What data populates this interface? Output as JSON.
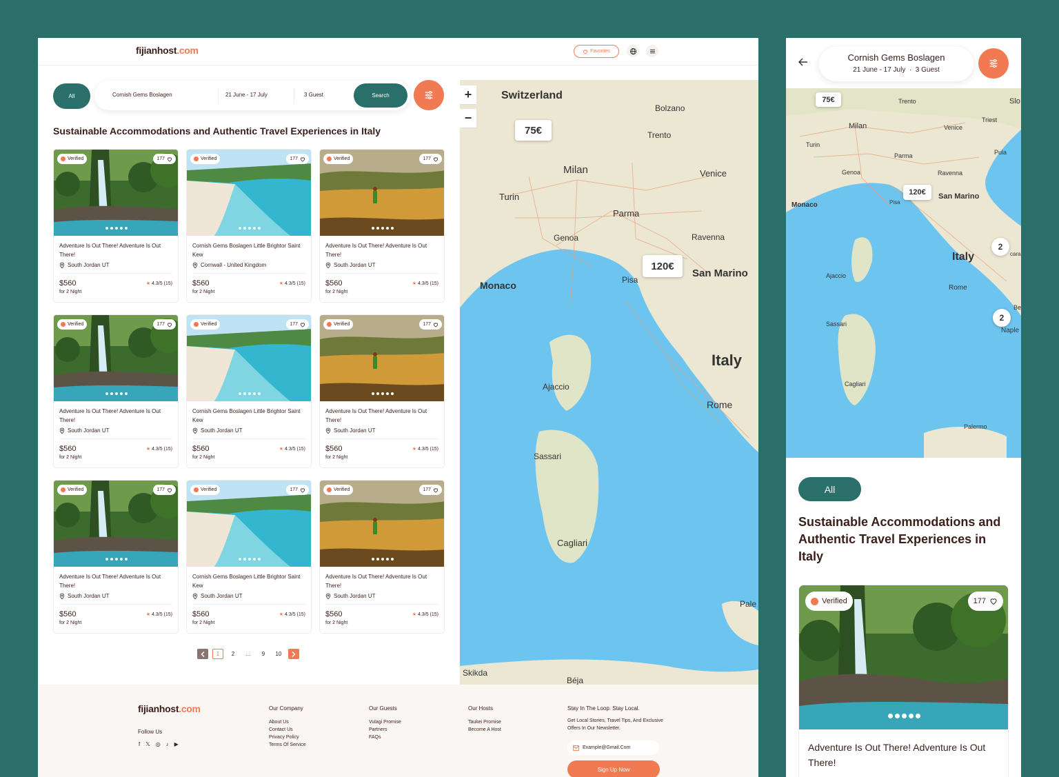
{
  "brand": {
    "name": "fijianhost",
    "tld": ".com"
  },
  "colors": {
    "accent": "#f27a52",
    "primary": "#2a6f6a",
    "text": "#3a1e1a",
    "sea": "#6dc5ef",
    "land": "#ece7d2"
  },
  "desktop": {
    "header": {
      "favorites": "Favorites",
      "icons": [
        "globe-icon",
        "menu-icon"
      ]
    },
    "filter_all": "All",
    "search": {
      "destination": "Cornish Gems Boslagen",
      "dates": "21 June - 17 July",
      "guests": "3 Guest",
      "button": "Search"
    },
    "heading": "Sustainable Accommodations and Authentic Travel Experiences in Italy",
    "listings": [
      {
        "badge": "Verified",
        "likes": "177",
        "title": "Adventure Is Out There! Adventure Is Out There!",
        "location": "South Jordan UT",
        "price": "$560",
        "nights": "for 2 Night",
        "rating": "4.3/5 (15)",
        "scene": "waterfall"
      },
      {
        "badge": "Verified",
        "likes": "177",
        "title": "Cornish Gems Boslagen Little Brightor Saint Kew",
        "location": "Cornwall - United Kingdom",
        "price": "$560",
        "nights": "for 2 Night",
        "rating": "4.3/5 (15)",
        "scene": "beach"
      },
      {
        "badge": "Verified",
        "likes": "177",
        "title": "Adventure Is Out There! Adventure Is Out There!",
        "location": "South Jordan UT",
        "price": "$560",
        "nights": "for 2 Night",
        "rating": "4.3/5 (15)",
        "scene": "dunes"
      },
      {
        "badge": "Verified",
        "likes": "177",
        "title": "Adventure Is Out There! Adventure Is Out There!",
        "location": "South Jordan UT",
        "price": "$560",
        "nights": "for 2 Night",
        "rating": "4.3/5 (15)",
        "scene": "waterfall"
      },
      {
        "badge": "Verified",
        "likes": "177",
        "title": "Cornish Gems Boslagen Little Brightor Saint Kew",
        "location": "South Jordan UT",
        "price": "$560",
        "nights": "for 2 Night",
        "rating": "4.3/5 (15)",
        "scene": "beach"
      },
      {
        "badge": "Verified",
        "likes": "177",
        "title": "Adventure Is Out There! Adventure Is Out There!",
        "location": "South Jordan UT",
        "price": "$560",
        "nights": "for 2 Night",
        "rating": "4.3/5 (15)",
        "scene": "dunes"
      },
      {
        "badge": "Verified",
        "likes": "177",
        "title": "Adventure Is Out There! Adventure Is Out There!",
        "location": "South Jordan UT",
        "price": "$560",
        "nights": "for 2 Night",
        "rating": "4.3/5 (15)",
        "scene": "waterfall"
      },
      {
        "badge": "Verified",
        "likes": "177",
        "title": "Cornish Gems Boslagen Little Brightor Saint Kew",
        "location": "South Jordan UT",
        "price": "$560",
        "nights": "for 2 Night",
        "rating": "4.3/5 (15)",
        "scene": "beach"
      },
      {
        "badge": "Verified",
        "likes": "177",
        "title": "Adventure Is Out There! Adventure Is Out There!",
        "location": "South Jordan UT",
        "price": "$560",
        "nights": "for 2 Night",
        "rating": "4.3/5 (15)",
        "scene": "dunes"
      }
    ],
    "pagination": {
      "pages": [
        "1",
        "2",
        "...",
        "9",
        "10"
      ],
      "current": "1"
    },
    "map": {
      "zoom_in": "+",
      "zoom_out": "−",
      "price_tags": [
        "75€",
        "120€"
      ],
      "labels": [
        "Switzerland",
        "Bolzano",
        "Trento",
        "Milan",
        "Venice",
        "Turin",
        "Parma",
        "Genoa",
        "Ravenna",
        "Monaco",
        "Pisa",
        "San Marino",
        "Italy",
        "Ajaccio",
        "Rome",
        "Sassari",
        "Cagliari",
        "Pale",
        "Skikda",
        "Béja"
      ]
    }
  },
  "footer": {
    "follow": "Follow Us",
    "socials": [
      "f",
      "𝕏",
      "◎",
      "♪",
      "▶"
    ],
    "company": {
      "title": "Our Company",
      "items": [
        "About Us",
        "Contact Us",
        "Privacy Policy",
        "Terms Of Service"
      ]
    },
    "guests": {
      "title": "Our Guests",
      "items": [
        "Vulagi Promise",
        "Partners",
        "FAQs"
      ]
    },
    "hosts": {
      "title": "Our Hosts",
      "items": [
        "Taukei Promise",
        "Become A Host"
      ]
    },
    "newsletter": {
      "title": "Stay In The Loop. Stay Local.",
      "text": "Get Local Stories, Travel Tips, And Exclusive Offers In Our Newsletter.",
      "placeholder": "Example@Gmail.Com",
      "button": "Sign Up Now"
    }
  },
  "mobile": {
    "search": {
      "destination": "Cornish Gems Boslagen",
      "dates": "21 June - 17 July",
      "guests": "3 Guest"
    },
    "map": {
      "price_tags": [
        "75€",
        "120€"
      ],
      "clusters": [
        "2",
        "2"
      ],
      "labels": [
        "Trento",
        "Slo",
        "Milan",
        "Venice",
        "Triest",
        "Turin",
        "Parma",
        "Pula",
        "Genoa",
        "Ravenna",
        "Monaco",
        "Pisa",
        "San Marino",
        "Italy",
        "Ajaccio",
        "Rome",
        "Sassari",
        "Cagliari",
        "Palermo",
        "Naple",
        "Be",
        "cara"
      ]
    },
    "filter_all": "All",
    "heading": "Sustainable Accommodations and Authentic Travel Experiences in Italy",
    "card": {
      "badge": "Verified",
      "likes": "177",
      "title": "Adventure Is Out There! Adventure Is Out There!"
    }
  }
}
